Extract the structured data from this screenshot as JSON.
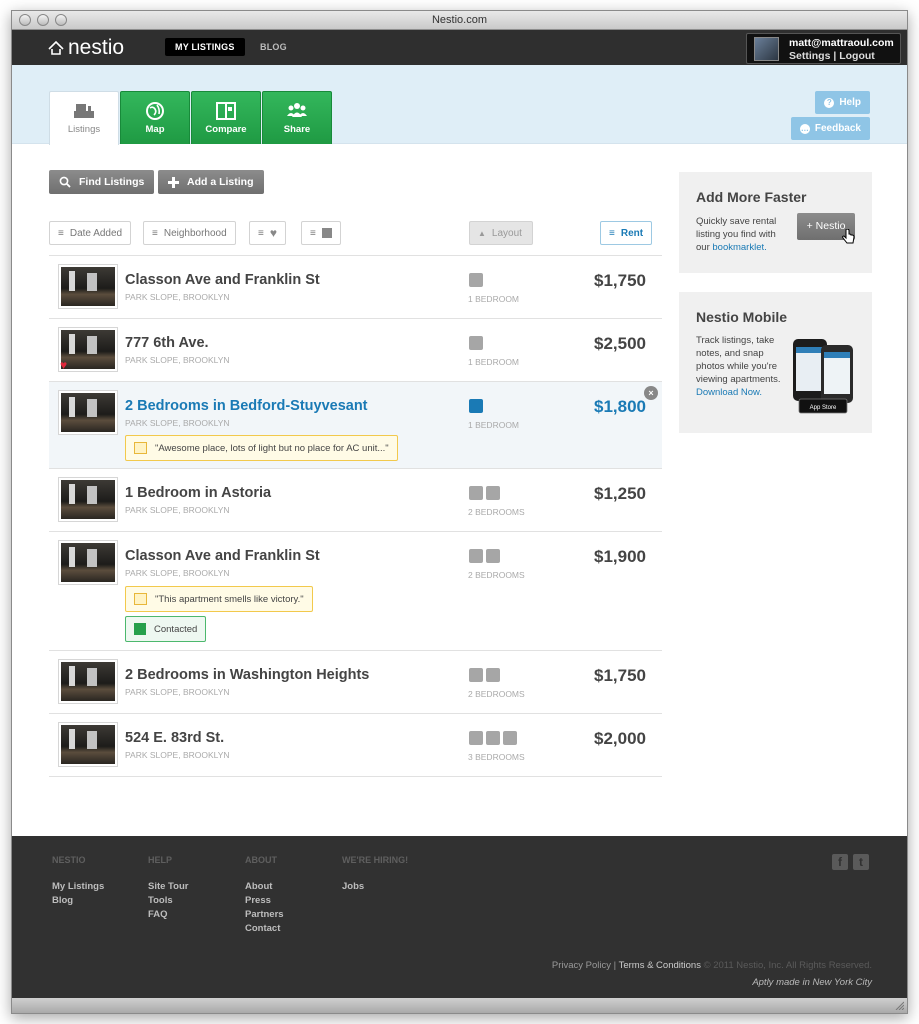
{
  "window": {
    "title": "Nestio.com"
  },
  "topnav": {
    "logo": "nestio",
    "links": [
      "MY LISTINGS",
      "BLOG"
    ],
    "user": {
      "email": "matt@mattraoul.com",
      "settings": "Settings",
      "separator": "|",
      "logout": "Logout"
    }
  },
  "tabs": [
    {
      "label": "Listings",
      "icon": "listings-icon"
    },
    {
      "label": "Map",
      "icon": "globe-icon"
    },
    {
      "label": "Compare",
      "icon": "compare-icon"
    },
    {
      "label": "Share",
      "icon": "people-icon"
    }
  ],
  "side_buttons": {
    "help": "Help",
    "feedback": "Feedback"
  },
  "actions": {
    "find": "Find Listings",
    "add": "Add a Listing"
  },
  "filters": {
    "date_added": "Date Added",
    "neighborhood": "Neighborhood",
    "layout": "Layout",
    "rent": "Rent"
  },
  "listings": [
    {
      "name": "Classon Ave and Franklin St",
      "hood": "PARK SLOPE, BROOKLYN",
      "beds": 1,
      "bed_label": "1 BEDROOM",
      "price": "$1,750"
    },
    {
      "name": "777 6th Ave.",
      "hood": "PARK SLOPE, BROOKLYN",
      "beds": 1,
      "bed_label": "1 BEDROOM",
      "price": "$2,500",
      "favorite": true
    },
    {
      "name": "2 Bedrooms in Bedford-Stuyvesant",
      "hood": "PARK SLOPE, BROOKLYN",
      "beds": 1,
      "bed_label": "1 BEDROOM",
      "price": "$1,800",
      "note": "\"Awesome place, lots of light but no place for AC unit...\"",
      "selected": true
    },
    {
      "name": "1 Bedroom in Astoria",
      "hood": "PARK SLOPE, BROOKLYN",
      "beds": 2,
      "bed_label": "2 BEDROOMS",
      "price": "$1,250"
    },
    {
      "name": "Classon Ave and Franklin St",
      "hood": "PARK SLOPE, BROOKLYN",
      "beds": 2,
      "bed_label": "2 BEDROOMS",
      "price": "$1,900",
      "note": "\"This apartment smells like victory.\"",
      "status": "Contacted"
    },
    {
      "name": "2 Bedrooms in Washington Heights",
      "hood": "PARK SLOPE, BROOKLYN",
      "beds": 2,
      "bed_label": "2 BEDROOMS",
      "price": "$1,750"
    },
    {
      "name": "524 E. 83rd St.",
      "hood": "PARK SLOPE, BROOKLYN",
      "beds": 3,
      "bed_label": "3 BEDROOMS",
      "price": "$2,000"
    }
  ],
  "panel_faster": {
    "title": "Add More Faster",
    "text1": "Quickly save rental",
    "text2": "listing you find with",
    "text3": "our",
    "link": "bookmarklet.",
    "button": "+ Nestio"
  },
  "panel_mobile": {
    "title": "Nestio Mobile",
    "lines": [
      "Track listings, take",
      "notes, and snap",
      "photos while you're",
      "viewing apartments."
    ],
    "link": "Download Now."
  },
  "footer": {
    "columns": [
      {
        "heading": "NESTIO",
        "links": [
          "My Listings",
          "Blog"
        ]
      },
      {
        "heading": "HELP",
        "links": [
          "Site Tour",
          "Tools",
          "FAQ"
        ]
      },
      {
        "heading": "ABOUT",
        "links": [
          "About",
          "Press",
          "Partners",
          "Contact"
        ]
      },
      {
        "heading": "WE'RE HIRING!",
        "links": [
          "Jobs"
        ]
      }
    ],
    "privacy": "Privacy Policy",
    "sep": "|",
    "terms": "Terms & Conditions",
    "copyright": "© 2011 Nestio, Inc. All Rights Reserved.",
    "made": "Aptly made in New York City"
  },
  "colors": {
    "green": "#22a34a",
    "blue": "#1a7ab5",
    "dark": "#2f2f2f",
    "band": "#dfeef7"
  }
}
